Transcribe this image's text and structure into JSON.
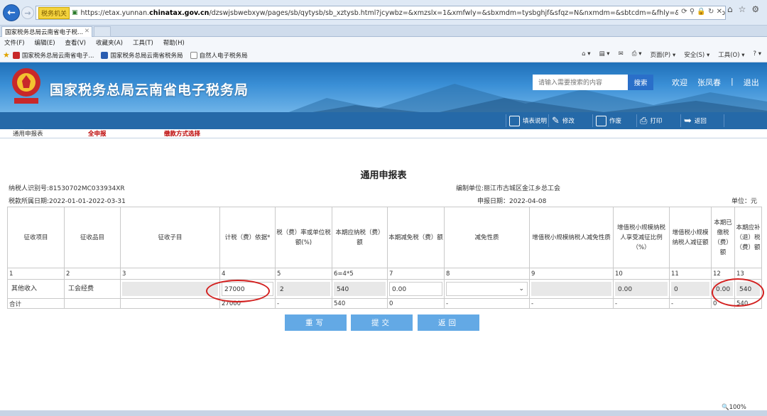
{
  "browser": {
    "badge": "税务机关",
    "url_prefix": "https://etax.yunnan.",
    "url_domain": "chinatax.gov.cn",
    "url_rest": "/dzswjsbwebxyw/pages/sb/qytysb/sb_xztysb.html?jcywbz=&xmzslx=1&xmfwly=&sbxmdm=tysbghjf&sfqz=N&nxmdm=&sbtcdm=&fhly=&hbsblx=&xsbt=&pzxh=1247562638629",
    "tab_title": "国家税务总局云南省电子税...",
    "menu": [
      "文件(F)",
      "编辑(E)",
      "查看(V)",
      "收藏夹(A)",
      "工具(T)",
      "帮助(H)"
    ],
    "favorites": [
      "国家税务总局云南省电子...",
      "国家税务总局云南省税务局",
      "自然人电子税务局"
    ],
    "right_tools": [
      "页面(P) ▾",
      "安全(S) ▾",
      "工具(O) ▾"
    ],
    "zoom": "🔍100%"
  },
  "site": {
    "title": "国家税务总局云南省电子税务局",
    "search_placeholder": "请输入需要搜索的内容",
    "search_btn": "搜索",
    "welcome": "欢迎",
    "user": "张凤春",
    "logout": "退出"
  },
  "toolbar": {
    "items": [
      "填表说明",
      "修改",
      "作废",
      "打印",
      "返回"
    ]
  },
  "subnav": {
    "item1": "通用申报表",
    "item2": "全申报",
    "item3": "缴款方式选择"
  },
  "form": {
    "title": "通用申报表",
    "taxpayer_id": "纳税人识别号:81530702MC033934XR",
    "period": "税款所属日期:2022-01-01-2022-03-31",
    "unit_org": "编制单位:丽江市古城区金江乡总工会",
    "filing_date": "申报日期：2022-04-08",
    "currency_unit": "单位：元",
    "headers": [
      "征收项目",
      "征收品目",
      "征收子目",
      "计税（费）依据*",
      "税（费）率或单位税额(%)",
      "本期应纳税（费）额",
      "本期减免税（费）额",
      "减免性质",
      "增值税小规模纳税人减免性质",
      "增值税小规模纳税人享受减征比例（%）",
      "增值税小规模纳税人减征额",
      "本期已缴税（费）额",
      "本期应补（退）税（费）额"
    ],
    "col_nums": [
      "1",
      "2",
      "3",
      "4",
      "5",
      "6=4*5",
      "7",
      "8",
      "9",
      "10",
      "11",
      "12",
      "13"
    ],
    "row": [
      "其他收入",
      "工会经费",
      "",
      "27000",
      "2",
      "540",
      "0.00",
      "",
      "",
      "0.00",
      "0",
      "0.00",
      "540"
    ],
    "total": [
      "合计",
      "",
      "",
      "27000",
      "-",
      "540",
      "0",
      "-",
      "-",
      "-",
      "-",
      "0",
      "540"
    ]
  },
  "buttons": {
    "reset": "重写",
    "submit": "提交",
    "back": "返回"
  }
}
